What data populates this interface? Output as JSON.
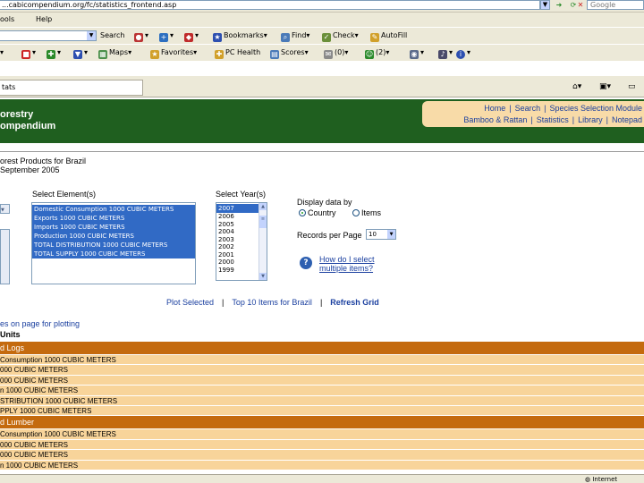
{
  "browser": {
    "address": "...cabicompendium.org/fc/statistics_frontend.asp",
    "search_placeholder": "Google",
    "menu": [
      "ools",
      "Help"
    ],
    "toolbar1": {
      "search_label": "Search",
      "bookmarks_label": "Bookmarks",
      "find_label": "Find",
      "check_label": "Check",
      "autofill_label": "AutoFill"
    },
    "toolbar2": {
      "maps_label": "Maps",
      "favorites_label": "Favorites",
      "pchealth_label": "PC Health",
      "scores_label": "Scores",
      "mail_count": "(0)",
      "im_count": "(2)"
    },
    "tab_title": "tats",
    "status_zone": "Internet"
  },
  "site": {
    "title_line1": "orestry",
    "title_line2": "ompendium",
    "nav_line1": [
      "Home",
      "Search",
      "Species Selection Module"
    ],
    "nav_line2": [
      "Bamboo & Rattan",
      "Statistics",
      "Library",
      "Notepad"
    ]
  },
  "page": {
    "heading_line1": "orest Products for Brazil",
    "heading_line2": "September 2005",
    "select_element_label": "Select Element(s)",
    "select_years_label": "Select Year(s)",
    "elements": [
      "Domestic Consumption 1000 CUBIC METERS",
      "Exports 1000 CUBIC METERS",
      "Imports 1000 CUBIC METERS",
      "Production 1000 CUBIC METERS",
      "TOTAL DISTRIBUTION 1000 CUBIC METERS",
      "TOTAL SUPPLY 1000 CUBIC METERS"
    ],
    "years": [
      "2007",
      "2006",
      "2005",
      "2004",
      "2003",
      "2002",
      "2001",
      "2000",
      "1999"
    ],
    "display_by_label": "Display data by",
    "display_country": "Country",
    "display_items": "Items",
    "records_label": "Records per Page",
    "records_value": "10",
    "help_line1": "How do I select",
    "help_line2": "multiple items?",
    "action_plot": "Plot Selected",
    "action_top10": "Top 10 Items for Brazil",
    "action_refresh": "Refresh Grid",
    "hint": "es on page for plotting",
    "units": "Units"
  },
  "grid": [
    {
      "group": "d Logs",
      "rows": [
        "Consumption 1000 CUBIC METERS",
        "000 CUBIC METERS",
        "000 CUBIC METERS",
        "n 1000 CUBIC METERS",
        "STRIBUTION 1000 CUBIC METERS",
        "PPLY 1000 CUBIC METERS"
      ]
    },
    {
      "group": "d Lumber",
      "rows": [
        "Consumption 1000 CUBIC METERS",
        "000 CUBIC METERS",
        "000 CUBIC METERS",
        "n 1000 CUBIC METERS"
      ]
    }
  ]
}
